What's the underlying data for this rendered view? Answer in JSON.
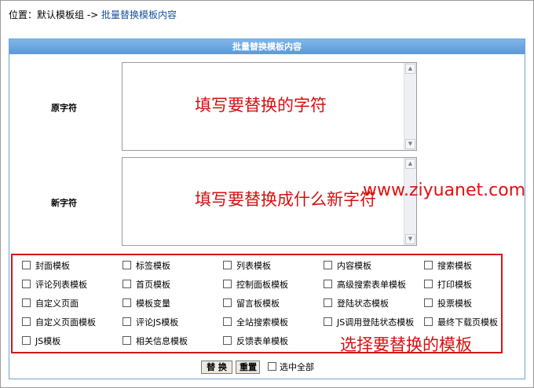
{
  "breadcrumb": {
    "prefix": "位置：",
    "group": "默认模板组",
    "separator": " -> ",
    "current": "批量替换模板内容"
  },
  "panel": {
    "title": "批量替换模板内容"
  },
  "fields": {
    "original_label": "原字符",
    "original_hint": "填写要替换的字符",
    "new_label": "新字符",
    "new_hint": "填写要替换成什么新字符"
  },
  "watermark": "www.ziyuanet.com",
  "templates": [
    [
      "封面模板",
      "标签模板",
      "列表模板",
      "内容模板",
      "搜索模板"
    ],
    [
      "评论列表模板",
      "首页模板",
      "控制面板模板",
      "高级搜索表单模板",
      "打印模板"
    ],
    [
      "自定义页面",
      "模板变量",
      "留言板模板",
      "登陆状态模板",
      "投票模板"
    ],
    [
      "自定义页面模板",
      "评论JS模板",
      "全站搜索模板",
      "JS调用登陆状态模板",
      "最终下载页模板"
    ],
    [
      "JS模板",
      "相关信息模板",
      "反馈表单模板"
    ]
  ],
  "select_hint": "选择要替换的模板",
  "actions": {
    "replace": "替 换",
    "reset": "重置",
    "select_all": "选中全部"
  }
}
